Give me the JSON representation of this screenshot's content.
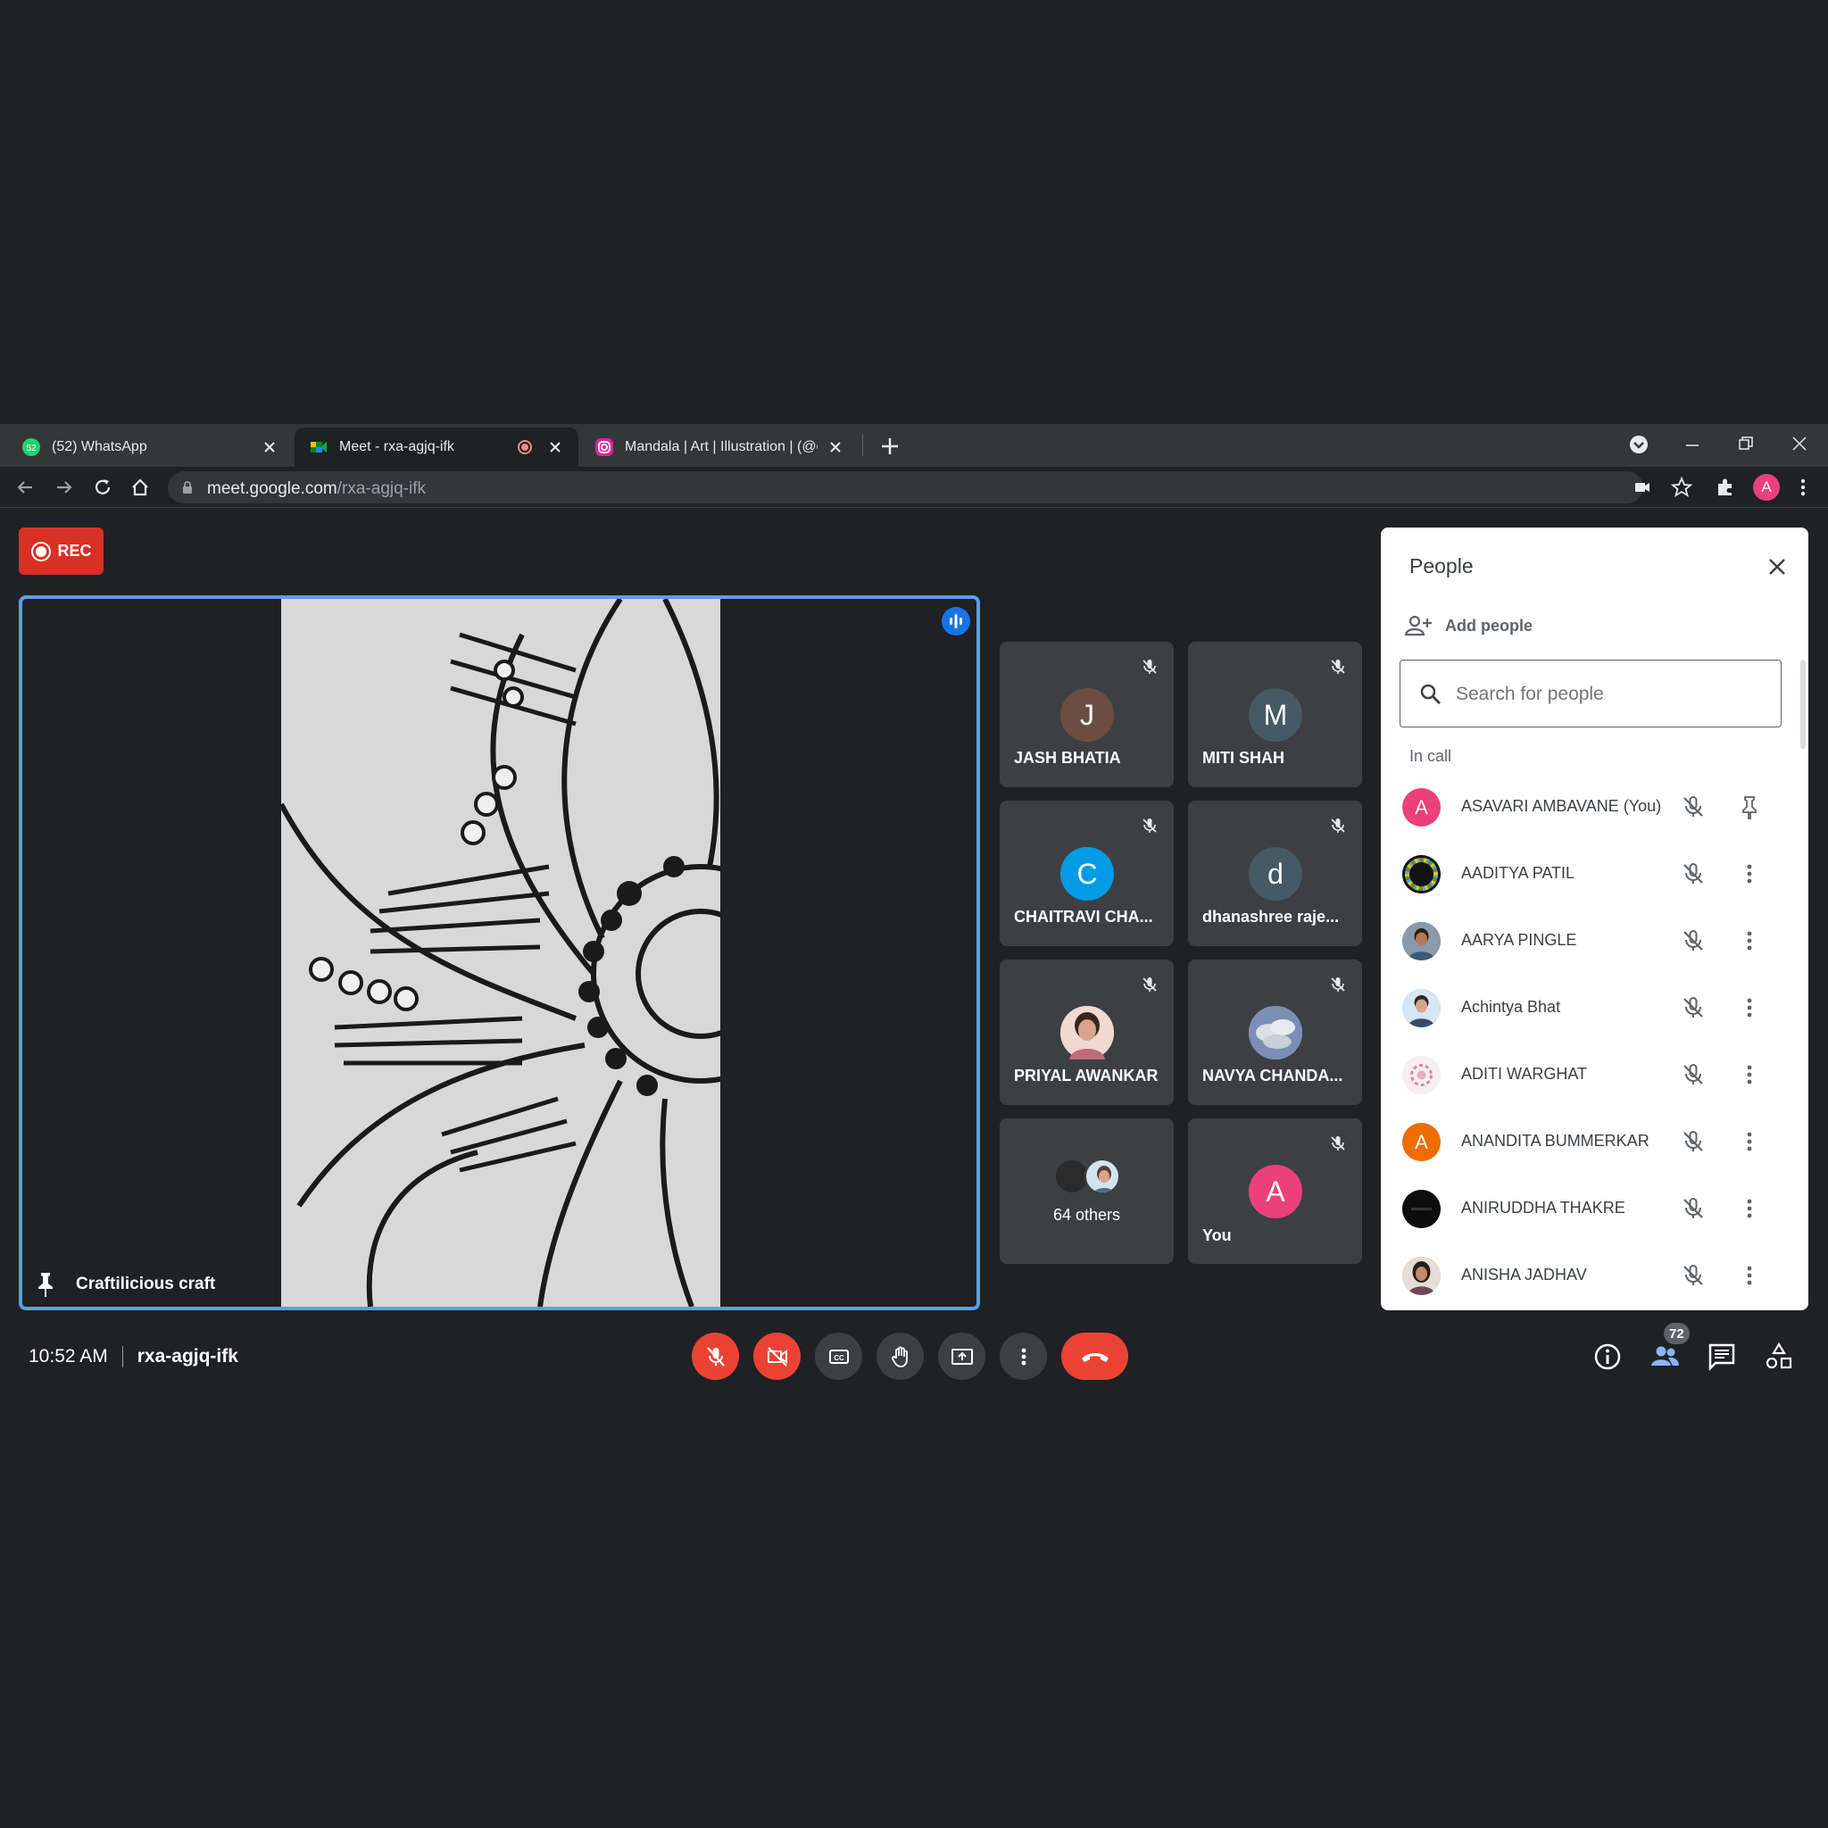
{
  "browser": {
    "tabs": [
      {
        "title": "(52) WhatsApp",
        "badge": "52",
        "active": false
      },
      {
        "title": "Meet - rxa-agjq-ifk",
        "active": true
      },
      {
        "title": "Mandala | Art | Illustration | (@cr",
        "active": false
      }
    ],
    "url_host": "meet.google.com",
    "url_path": "/rxa-agjq-ifk",
    "profile_initial": "A"
  },
  "meet": {
    "rec_label": "REC",
    "main_tile_name": "Craftilicious craft",
    "tiles": [
      {
        "name": "JASH BHATIA",
        "initial": "J",
        "color": "#6d4c41"
      },
      {
        "name": "MITI SHAH",
        "initial": "M",
        "color": "#455a64"
      },
      {
        "name": "CHAITRAVI CHA...",
        "initial": "C",
        "color": "#039be5"
      },
      {
        "name": "dhanashree raje...",
        "initial": "d",
        "color": "#455a64"
      },
      {
        "name": "PRIYAL AWANKAR",
        "initial": "",
        "color": "#e6b3a8"
      },
      {
        "name": "NAVYA CHANDA...",
        "initial": "",
        "color": "#8aa0c0"
      },
      {
        "name": "64 others",
        "initial": "",
        "color": ""
      },
      {
        "name": "You",
        "initial": "A",
        "color": "#ec407a"
      }
    ],
    "time": "10:52 AM",
    "meeting_code": "rxa-agjq-ifk",
    "people_count": "72"
  },
  "people_panel": {
    "title": "People",
    "add_people_label": "Add people",
    "search_placeholder": "Search for people",
    "section_label": "In call",
    "people": [
      {
        "name": "ASAVARI AMBAVANE (You)",
        "initial": "A",
        "color": "#ec407a",
        "action": "pin-icon"
      },
      {
        "name": "AADITYA PATIL",
        "initial": "",
        "color": "#222222",
        "action": "more-icon"
      },
      {
        "name": "AARYA PINGLE",
        "initial": "",
        "color": "#7a6a5a",
        "action": "more-icon"
      },
      {
        "name": "Achintya Bhat",
        "initial": "",
        "color": "#a8c0d8",
        "action": "more-icon"
      },
      {
        "name": "ADITI WARGHAT",
        "initial": "",
        "color": "#f3e6ea",
        "action": "more-icon"
      },
      {
        "name": "ANANDITA BUMMERKAR",
        "initial": "A",
        "color": "#ef6c00",
        "action": "more-icon"
      },
      {
        "name": "ANIRUDDHA THAKRE",
        "initial": "",
        "color": "#111111",
        "action": "more-icon"
      },
      {
        "name": "ANISHA JADHAV",
        "initial": "",
        "color": "#b59a88",
        "action": "more-icon"
      }
    ]
  }
}
